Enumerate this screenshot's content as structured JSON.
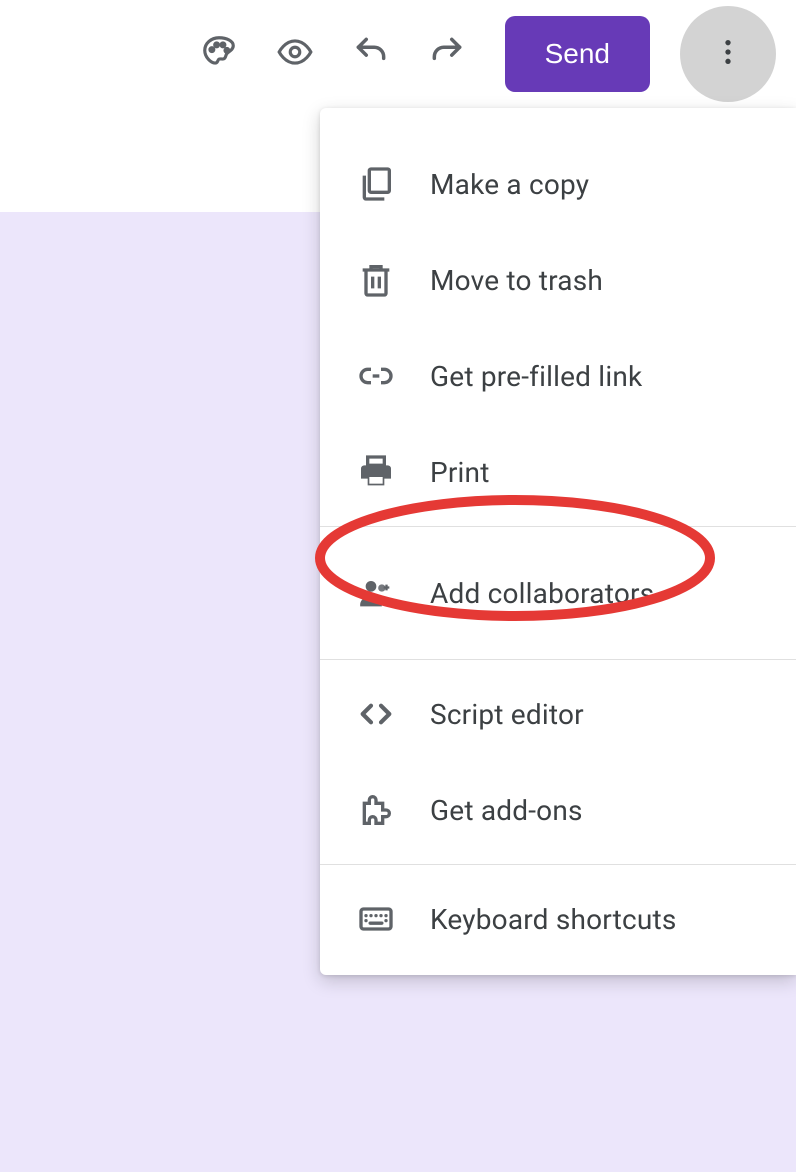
{
  "toolbar": {
    "send_label": "Send"
  },
  "menu": {
    "items": [
      {
        "label": "Make a copy"
      },
      {
        "label": "Move to trash"
      },
      {
        "label": "Get pre-filled link"
      },
      {
        "label": "Print"
      },
      {
        "label": "Add collaborators"
      },
      {
        "label": "Script editor"
      },
      {
        "label": "Get add-ons"
      },
      {
        "label": "Keyboard shortcuts"
      }
    ]
  },
  "annotation": {
    "highlight_color": "#e53935"
  }
}
